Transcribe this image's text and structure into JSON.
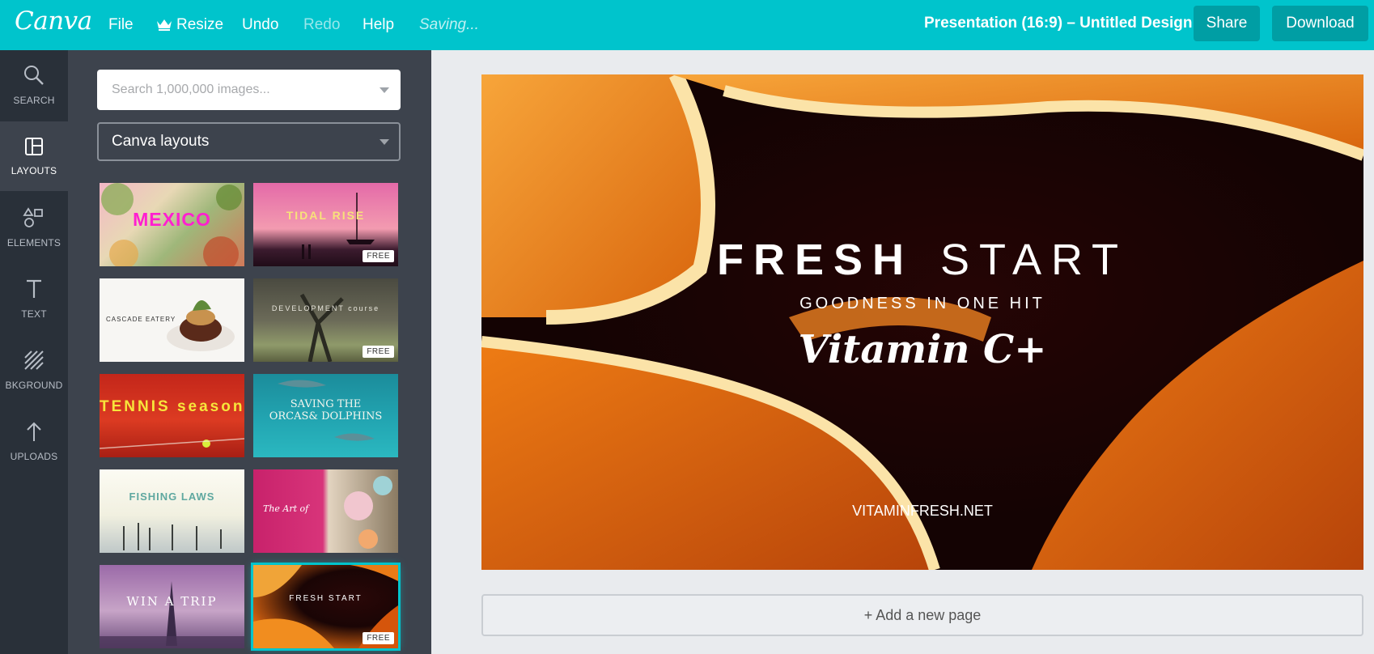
{
  "app": {
    "logo": "Canva"
  },
  "menu": {
    "file": "File",
    "resize": "Resize",
    "undo": "Undo",
    "redo": "Redo",
    "help": "Help",
    "status": "Saving..."
  },
  "doc_title": "Presentation (16:9) – Untitled Design",
  "buttons": {
    "share": "Share",
    "download": "Download"
  },
  "rail": [
    {
      "label": "SEARCH",
      "icon": "search-icon"
    },
    {
      "label": "LAYOUTS",
      "icon": "layouts-icon",
      "active": true
    },
    {
      "label": "ELEMENTS",
      "icon": "elements-icon"
    },
    {
      "label": "TEXT",
      "icon": "text-icon"
    },
    {
      "label": "BKGROUND",
      "icon": "background-icon"
    },
    {
      "label": "UPLOADS",
      "icon": "uploads-icon"
    }
  ],
  "panel": {
    "search_placeholder": "Search 1,000,000 images...",
    "layout_select": "Canva layouts",
    "thumbs": [
      {
        "title": "MEXICO",
        "free": ""
      },
      {
        "title": "TIDAL RISE",
        "free": "FREE"
      },
      {
        "title": "CASCADE EATERY",
        "free": ""
      },
      {
        "title": "DEVELOPMENT course",
        "free": "FREE"
      },
      {
        "title": "TENNIS season",
        "free": ""
      },
      {
        "title": "SAVING THE ORCAS& DOLPHINS",
        "free": ""
      },
      {
        "title": "FISHING LAWS",
        "free": ""
      },
      {
        "title": "The Art of",
        "free": ""
      },
      {
        "title": "WIN A TRIP",
        "free": ""
      },
      {
        "title": "FRESH START",
        "free": "FREE",
        "selected": true
      }
    ]
  },
  "design": {
    "headline_bold": "FRESH",
    "headline_light": "START",
    "subtitle": "GOODNESS IN ONE HIT",
    "script": "Vitamin C+",
    "url": "VITAMINFRESH.NET"
  },
  "add_page": "+ Add a new page",
  "colors": {
    "brand": "#00c4cc",
    "rail": "#293039",
    "panel": "#3d434d",
    "button": "#009ea4"
  }
}
